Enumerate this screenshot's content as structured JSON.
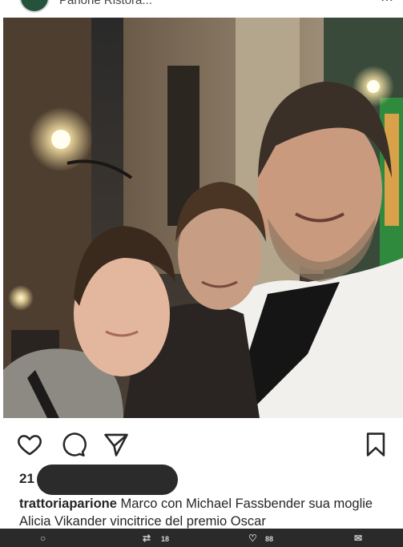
{
  "header": {
    "location": "Parione Ristora...",
    "avatar_color": "#25523b"
  },
  "post": {
    "actions": {
      "like_icon": "heart-icon",
      "comment_icon": "comment-icon",
      "share_icon": "send-icon",
      "save_icon": "bookmark-icon"
    },
    "likes_prefix": "21",
    "caption_user": "trattoriaparione",
    "caption_text": "Marco con Michael Fassbender sua moglie Alicia Vikander vincitrice del premio Oscar"
  },
  "bottom_bar": {
    "reply_icon": "reply-icon",
    "retweet_icon": "retweet-icon",
    "retweet_count": "18",
    "like_icon": "heart-outline-icon",
    "like_count": "88",
    "message_icon": "envelope-icon"
  }
}
